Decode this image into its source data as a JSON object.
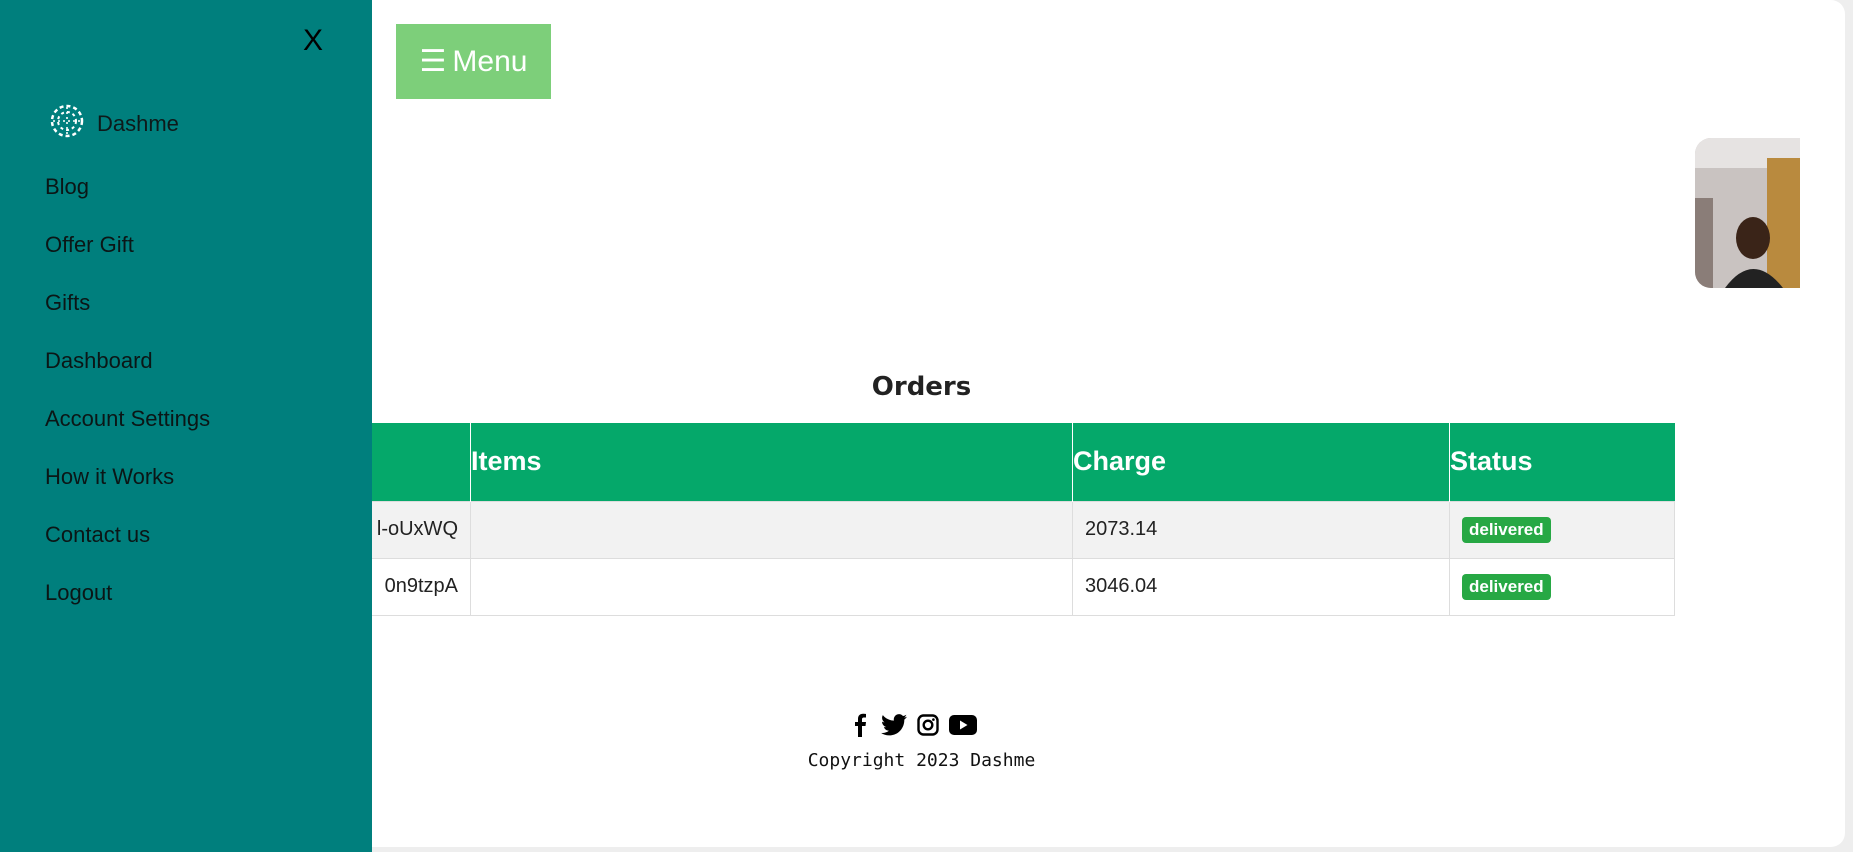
{
  "sidebar": {
    "close_label": "X",
    "brand": {
      "name": "Dashme",
      "icon": "dashme-logo-icon"
    },
    "items": [
      {
        "label": "Blog"
      },
      {
        "label": "Offer Gift"
      },
      {
        "label": "Gifts"
      },
      {
        "label": "Dashboard"
      },
      {
        "label": "Account Settings"
      },
      {
        "label": "How it Works"
      },
      {
        "label": "Contact us"
      },
      {
        "label": "Logout"
      }
    ]
  },
  "header": {
    "menu_button": {
      "icon": "hamburger-icon",
      "glyph": "☰",
      "label": "Menu"
    }
  },
  "orders": {
    "title": "Orders",
    "columns": [
      "",
      "Items",
      "Charge",
      "Status"
    ],
    "rows": [
      {
        "id": "l-oUxWQ",
        "items": "",
        "charge": "2073.14",
        "status": "delivered"
      },
      {
        "id": "0n9tzpA",
        "items": "",
        "charge": "3046.04",
        "status": "delivered"
      }
    ]
  },
  "footer": {
    "social": [
      "facebook-icon",
      "twitter-icon",
      "instagram-icon",
      "youtube-icon"
    ],
    "copyright": "Copyright 2023 Dashme"
  },
  "colors": {
    "sidebar": "#007f7d",
    "menu_button": "#7dcf7a",
    "table_header": "#05a86a",
    "status_badge": "#27a844"
  }
}
